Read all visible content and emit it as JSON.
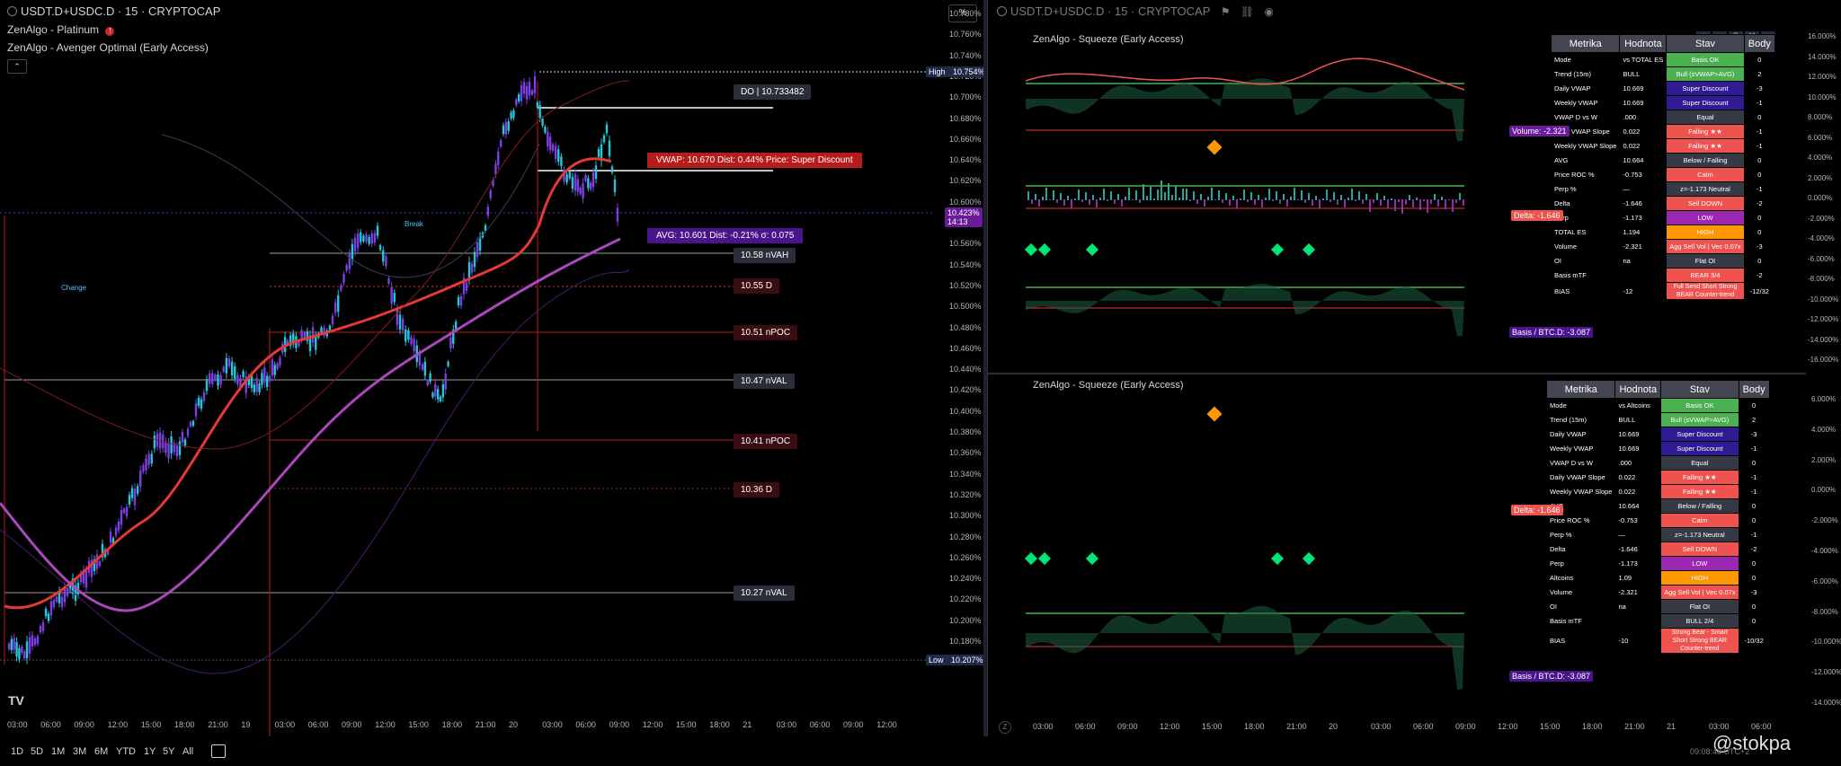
{
  "left": {
    "symbol_title": "USDT.D+USDC.D · 15 · CRYPTOCAP",
    "indicator1": "ZenAlgo - Platinum",
    "indicator2": "ZenAlgo - Avenger Optimal (Early Access)",
    "percent_button": "%",
    "price_axis": [
      "10.780%",
      "10.760%",
      "10.740%",
      "10.720%",
      "10.700%",
      "10.680%",
      "10.660%",
      "10.640%",
      "10.620%",
      "10.600%",
      "10.580%",
      "10.560%",
      "10.540%",
      "10.520%",
      "10.500%",
      "10.480%",
      "10.460%",
      "10.440%",
      "10.420%",
      "10.400%",
      "10.380%",
      "10.360%",
      "10.340%",
      "10.320%",
      "10.300%",
      "10.280%",
      "10.260%",
      "10.240%",
      "10.220%",
      "10.200%",
      "10.180%",
      "10.160%"
    ],
    "time_axis": [
      "03:00",
      "06:00",
      "09:00",
      "12:00",
      "15:00",
      "18:00",
      "21:00",
      "19",
      "03:00",
      "06:00",
      "09:00",
      "12:00",
      "15:00",
      "18:00",
      "21:00",
      "20",
      "03:00",
      "06:00",
      "09:00",
      "12:00",
      "15:00",
      "18:00",
      "21",
      "03:00",
      "06:00",
      "09:00",
      "12:00"
    ],
    "high_tag": {
      "label": "High",
      "value": "10.754%"
    },
    "current_tag": {
      "value": "10.423%",
      "countdown": "14:13"
    },
    "low_tag": {
      "label": "Low",
      "value": "10.207%"
    },
    "do_label": "DO | 10.733482",
    "vwap_callout": "VWAP: 10.670  Dist: 0.44%  Price: Super Discount",
    "avg_callout": "AVG: 10.601  Dist: -0.21%  σ: 0.075",
    "levels": [
      "10.58 nVAH",
      "10.55 D",
      "10.51 nPOC",
      "10.47 nVAL",
      "10.41 nPOC",
      "10.36 D",
      "10.27 nVAL"
    ],
    "chart_notes": {
      "break": "Break",
      "change": "Change"
    },
    "logo": "TV",
    "timeframes": [
      "1D",
      "5D",
      "1M",
      "3M",
      "6M",
      "YTD",
      "1Y",
      "5Y",
      "All"
    ],
    "colors": {
      "vwap": "#e53935",
      "avg": "#ab47bc",
      "candle_up": "#26c6da",
      "candle_down": "#7b3fe4"
    }
  },
  "right": {
    "symbol_title": "USDT.D+USDC.D · 15 · CRYPTOCAP",
    "panel_title": "ZenAlgo - Squeeze (Early Access)",
    "pct_axis_top": [
      "16.000%",
      "14.000%",
      "12.000%",
      "10.000%",
      "8.000%",
      "6.000%",
      "4.000%",
      "2.000%",
      "0.000%",
      "-2.000%",
      "-4.000%",
      "-6.000%",
      "-8.000%",
      "-10.000%",
      "-12.000%",
      "-14.000%",
      "-16.000%"
    ],
    "pct_axis_bottom": [
      "6.000%",
      "4.000%",
      "2.000%",
      "0.000%",
      "-2.000%",
      "-4.000%",
      "-6.000%",
      "-8.000%",
      "-10.000%",
      "-12.000%",
      "-14.000%"
    ],
    "time_axis": [
      "03:00",
      "06:00",
      "09:00",
      "12:00",
      "15:00",
      "18:00",
      "21:00",
      "20",
      "03:00",
      "06:00",
      "09:00",
      "12:00",
      "15:00",
      "18:00",
      "21:00",
      "21",
      "03:00",
      "06:00"
    ],
    "tags_top": {
      "delta": "Delta: -1.646",
      "basis": "Basis / BTC.D: -3.087",
      "volume": "Volume: -2.321"
    },
    "tags_bottom": {
      "delta": "Delta: -1.646",
      "basis": "Basis / BTC.D: -3.087"
    },
    "table_top": {
      "headers": [
        "Metrika",
        "Hodnota",
        "Stav",
        "Body"
      ],
      "rows": [
        [
          "Mode",
          "vs TOTAL ES",
          "Basis OK",
          "0",
          "#4caf50"
        ],
        [
          "Trend (15m)",
          "BULL",
          "Bull (sVWAP>AVG)",
          "2",
          "#4caf50"
        ],
        [
          "Daily VWAP",
          "10.669",
          "Super Discount",
          "-3",
          "#311b92"
        ],
        [
          "Weekly VWAP",
          "10.669",
          "Super Discount",
          "-1",
          "#311b92"
        ],
        [
          "VWAP D vs W",
          ".000",
          "Equal",
          "0",
          "#363a45"
        ],
        [
          "Daily VWAP Slope",
          "0.022",
          "Falling ★★",
          "-1",
          "#ef5350"
        ],
        [
          "Weekly VWAP Slope",
          "0.022",
          "Falling ★★",
          "-1",
          "#ef5350"
        ],
        [
          "AVG",
          "10.664",
          "Below / Falling",
          "0",
          "#363a45"
        ],
        [
          "Price ROC %",
          "-0.753",
          "Calm",
          "0",
          "#ef5350"
        ],
        [
          "Perp %",
          "—",
          "z=-1.173 Neutral",
          "-1",
          "#363a45"
        ],
        [
          "Delta",
          "-1.646",
          "Sell DOWN",
          "-2",
          "#ef5350"
        ],
        [
          "Perp",
          "-1.173",
          "LOW",
          "0",
          "#9c27b0"
        ],
        [
          "TOTAL ES",
          "1.194",
          "HIGH",
          "0",
          "#ff9800"
        ],
        [
          "Volume",
          "-2.321",
          "Agg Sell Vol | Vec 0.07x",
          "-3",
          "#ef5350"
        ],
        [
          "OI",
          "na",
          "Flat OI",
          "0",
          "#363a45"
        ],
        [
          "Basis mTF",
          "",
          "BEAR 3/4",
          "-2",
          "#ef5350"
        ],
        [
          "BIAS",
          "-12",
          "Full Send Short Strong BEAR Counter-trend",
          "-12/32",
          "#ef5350"
        ]
      ]
    },
    "table_bottom": {
      "headers": [
        "Metrika",
        "Hodnota",
        "Stav",
        "Body"
      ],
      "rows": [
        [
          "Mode",
          "vs Altcoins",
          "Basis OK",
          "0",
          "#4caf50"
        ],
        [
          "Trend (15m)",
          "BULL",
          "Bull (sVWAP>AVG)",
          "2",
          "#4caf50"
        ],
        [
          "Daily VWAP",
          "10.669",
          "Super Discount",
          "-3",
          "#311b92"
        ],
        [
          "Weekly VWAP",
          "10.669",
          "Super Discount",
          "-1",
          "#311b92"
        ],
        [
          "VWAP D vs W",
          ".000",
          "Equal",
          "0",
          "#363a45"
        ],
        [
          "Daily VWAP Slope",
          "0.022",
          "Falling ★★",
          "-1",
          "#ef5350"
        ],
        [
          "Weekly VWAP Slope",
          "0.022",
          "Falling ★★",
          "-1",
          "#ef5350"
        ],
        [
          "AVG",
          "10.664",
          "Below / Falling",
          "0",
          "#363a45"
        ],
        [
          "Price ROC %",
          "-0.753",
          "Calm",
          "0",
          "#ef5350"
        ],
        [
          "Perp %",
          "—",
          "z=-1.173 Neutral",
          "-1",
          "#363a45"
        ],
        [
          "Delta",
          "-1.646",
          "Sell DOWN",
          "-2",
          "#ef5350"
        ],
        [
          "Perp",
          "-1.173",
          "LOW",
          "0",
          "#9c27b0"
        ],
        [
          "Altcoins",
          "1.09",
          "HIGH",
          "0",
          "#ff9800"
        ],
        [
          "Volume",
          "-2.321",
          "Agg Sell Vol | Vec 0.07x",
          "-3",
          "#ef5350"
        ],
        [
          "OI",
          "na",
          "Flat OI",
          "0",
          "#363a45"
        ],
        [
          "Basis mTF",
          "",
          "BULL 2/4",
          "0",
          "#363a45"
        ],
        [
          "BIAS",
          "-10",
          "Strong Bear - Smart Short Strong BEAR Counter-trend",
          "-10/32",
          "#ef5350"
        ]
      ]
    },
    "watermark": "@stokpa",
    "clock": "09:08:48 UTC+2"
  }
}
